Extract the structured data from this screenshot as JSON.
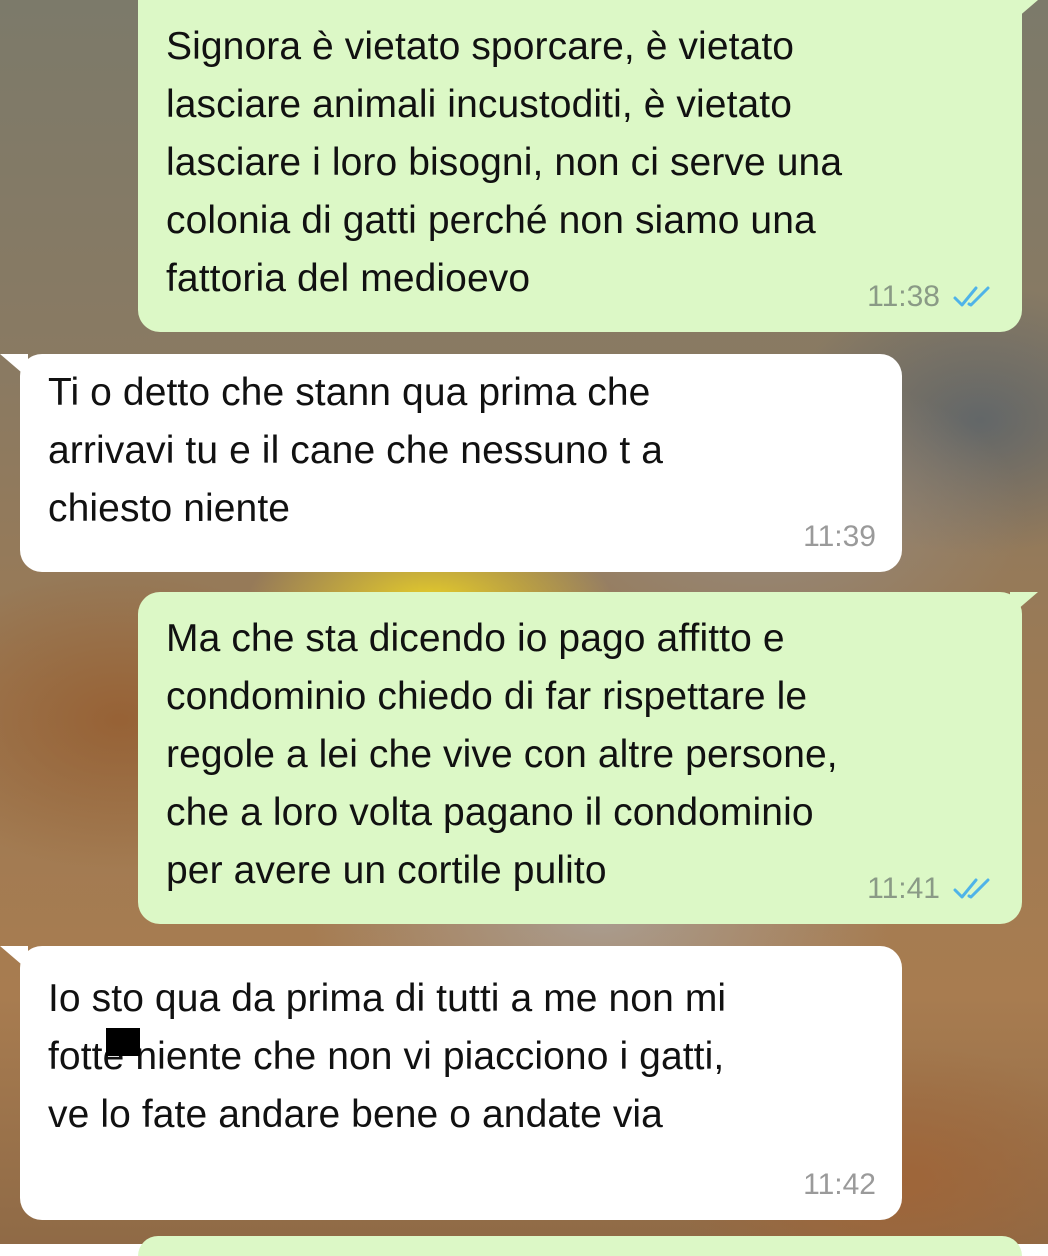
{
  "chat": {
    "messages": [
      {
        "direction": "outgoing",
        "text": "Signora è vietato sporcare, è vietato\nlasciare animali incustoditi, è vietato\nlasciare i loro bisogni, non ci serve una\ncolonia di gatti perché non siamo una\nfattoria del medioevo",
        "time": "11:38",
        "status": "read-double-check-icon"
      },
      {
        "direction": "incoming",
        "text": "Ti o detto che stann qua prima che\narrivavi tu e il cane che nessuno t a\nchiesto niente",
        "time": "11:39"
      },
      {
        "direction": "outgoing",
        "text": "Ma che sta dicendo io pago affitto e\ncondominio chiedo di far rispettare le\nregole a lei che vive con altre persone,\nche a loro volta pagano il condominio\nper avere un cortile pulito",
        "time": "11:41",
        "status": "read-double-check-icon"
      },
      {
        "direction": "incoming",
        "text": "Io sto qua da prima di tutti a me non mi\nfotte niente che non vi piacciono i gatti,\nve lo fate andare bene o andate via",
        "time": "11:42",
        "redacted_note": "partially covered word"
      }
    ]
  },
  "colors": {
    "outgoing_bubble": "#dcf8c6",
    "incoming_bubble": "#ffffff",
    "read_tick": "#4fb3e8",
    "timestamp": "#8a9a86"
  }
}
